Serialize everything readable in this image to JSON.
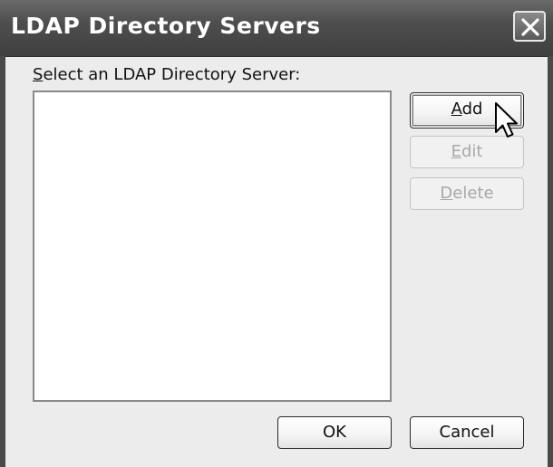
{
  "dialog": {
    "title": "LDAP Directory Servers",
    "list_label_mnemonic": "S",
    "list_label_rest": "elect an LDAP Directory Server:",
    "list_items": []
  },
  "buttons": {
    "add": {
      "mnemonic": "A",
      "rest": "dd",
      "enabled": true
    },
    "edit": {
      "mnemonic": "E",
      "rest": "dit",
      "enabled": false
    },
    "delete": {
      "mnemonic": "D",
      "rest": "elete",
      "enabled": false
    },
    "ok": "OK",
    "cancel": "Cancel"
  },
  "icons": {
    "close": "close-icon",
    "cursor": "mouse-pointer-icon"
  }
}
